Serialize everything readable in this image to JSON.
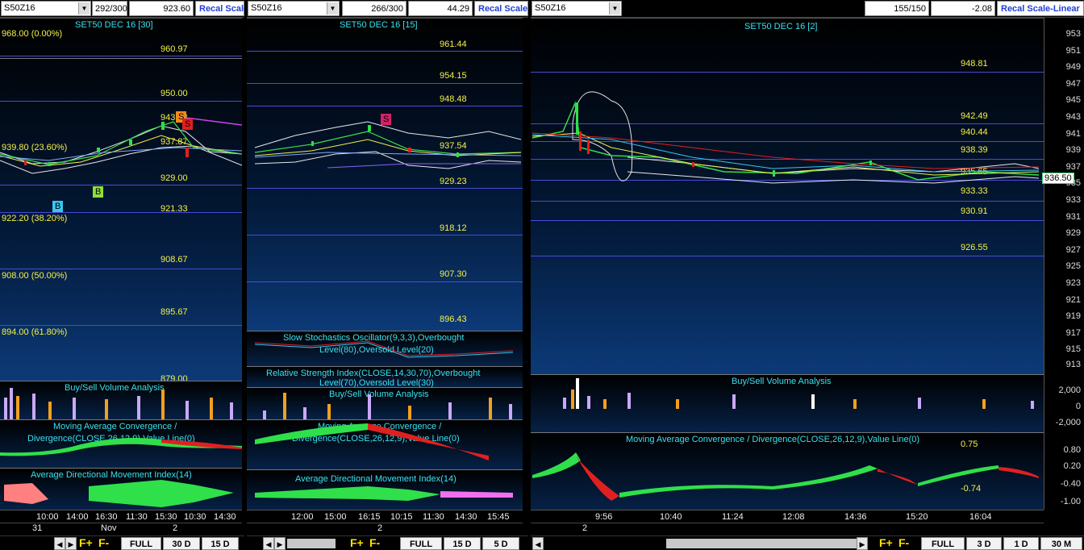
{
  "colors": {
    "bull": "#2fe04a",
    "bear": "#e02020",
    "level": "#f4f247",
    "title": "#39e1f0",
    "grid": "#4a4ad8"
  },
  "panels": [
    {
      "symbol": "S50Z16",
      "bars": "292/300",
      "value": "923.60",
      "recal": "Recal Scale",
      "title": "SET50 DEC 16  [30]",
      "levels": [
        "960.97",
        "950.00",
        "943.93",
        "937.87",
        "929.00",
        "921.33",
        "908.67",
        "895.67",
        "879.00"
      ],
      "fib": [
        "968.00 (0.00%)",
        "939.80 (23.60%)",
        "922.20 (38.20%)",
        "908.00 (50.00%)",
        "894.00 (61.80%)"
      ],
      "signals": [
        "S",
        "S",
        "B",
        "B"
      ],
      "sub_titles": [
        "Buy/Sell Volume Analysis",
        "Moving Average Convergence /",
        "Divergence(CLOSE,26,12,9),Value Line(0)",
        "Average Directional Movement Index(14)"
      ],
      "x_labels": [
        "10:00",
        "14:00",
        "16:30",
        "11:30",
        "15:30",
        "10:30",
        "14:30"
      ],
      "dates": [
        "31",
        "Nov",
        "2"
      ],
      "buttons": [
        "FULL",
        "30 D",
        "15 D"
      ]
    },
    {
      "symbol": "S50Z16",
      "bars": "266/300",
      "value": "44.29",
      "recal": "Recal Scale",
      "title": "SET50 DEC 16  [15]",
      "levels": [
        "961.44",
        "954.15",
        "948.48",
        "937.54",
        "929.23",
        "918.12",
        "907.30",
        "896.43"
      ],
      "signals": [
        "S"
      ],
      "sub_titles": [
        "Slow Stochastics Oscillator(9,3,3),Overbought",
        "Level(80),Oversold Level(20)",
        "Relative Strength Index(CLOSE,14,30,70),Overbought",
        "Level(70),Oversold Level(30)",
        "Buy/Sell Volume Analysis",
        "Moving Average Convergence /",
        "Divergence(CLOSE,26,12,9),Value Line(0)",
        "Average Directional Movement Index(14)"
      ],
      "x_labels": [
        "12:00",
        "15:00",
        "16:15",
        "10:15",
        "11:30",
        "14:30",
        "15:45"
      ],
      "dates": [
        "2"
      ],
      "buttons": [
        "FULL",
        "15 D",
        "5 D"
      ]
    },
    {
      "symbol": "S50Z16",
      "bars": "155/150",
      "value": "-2.08",
      "recal": "Recal Scale-Linear",
      "title": "SET50 DEC 16  [2]",
      "levels": [
        "948.81",
        "942.49",
        "940.44",
        "938.39",
        "935.65",
        "933.33",
        "930.91",
        "926.55"
      ],
      "y_axis": [
        "953",
        "951",
        "949",
        "947",
        "945",
        "943",
        "941",
        "939",
        "937",
        "935",
        "933",
        "931",
        "929",
        "927",
        "925",
        "923",
        "921",
        "919",
        "917",
        "915",
        "913"
      ],
      "current": "936.50",
      "sub_titles": [
        "Buy/Sell Volume Analysis",
        "Moving Average Convergence / Divergence(CLOSE,26,12,9),Value Line(0)"
      ],
      "vol_axis": [
        "2,000",
        "0",
        "-2,000"
      ],
      "macd_axis": [
        "0.80",
        "0.20",
        "-0.40",
        "-1.00"
      ],
      "macd_values": [
        "0.75",
        "-0.74"
      ],
      "x_labels": [
        "9:56",
        "10:40",
        "11:24",
        "12:08",
        "14:36",
        "15:20",
        "16:04"
      ],
      "dates": [
        "2"
      ],
      "buttons": [
        "FULL",
        "3 D",
        "1 D",
        "30 M"
      ]
    }
  ],
  "fplus": "F+",
  "fminus": "F-"
}
